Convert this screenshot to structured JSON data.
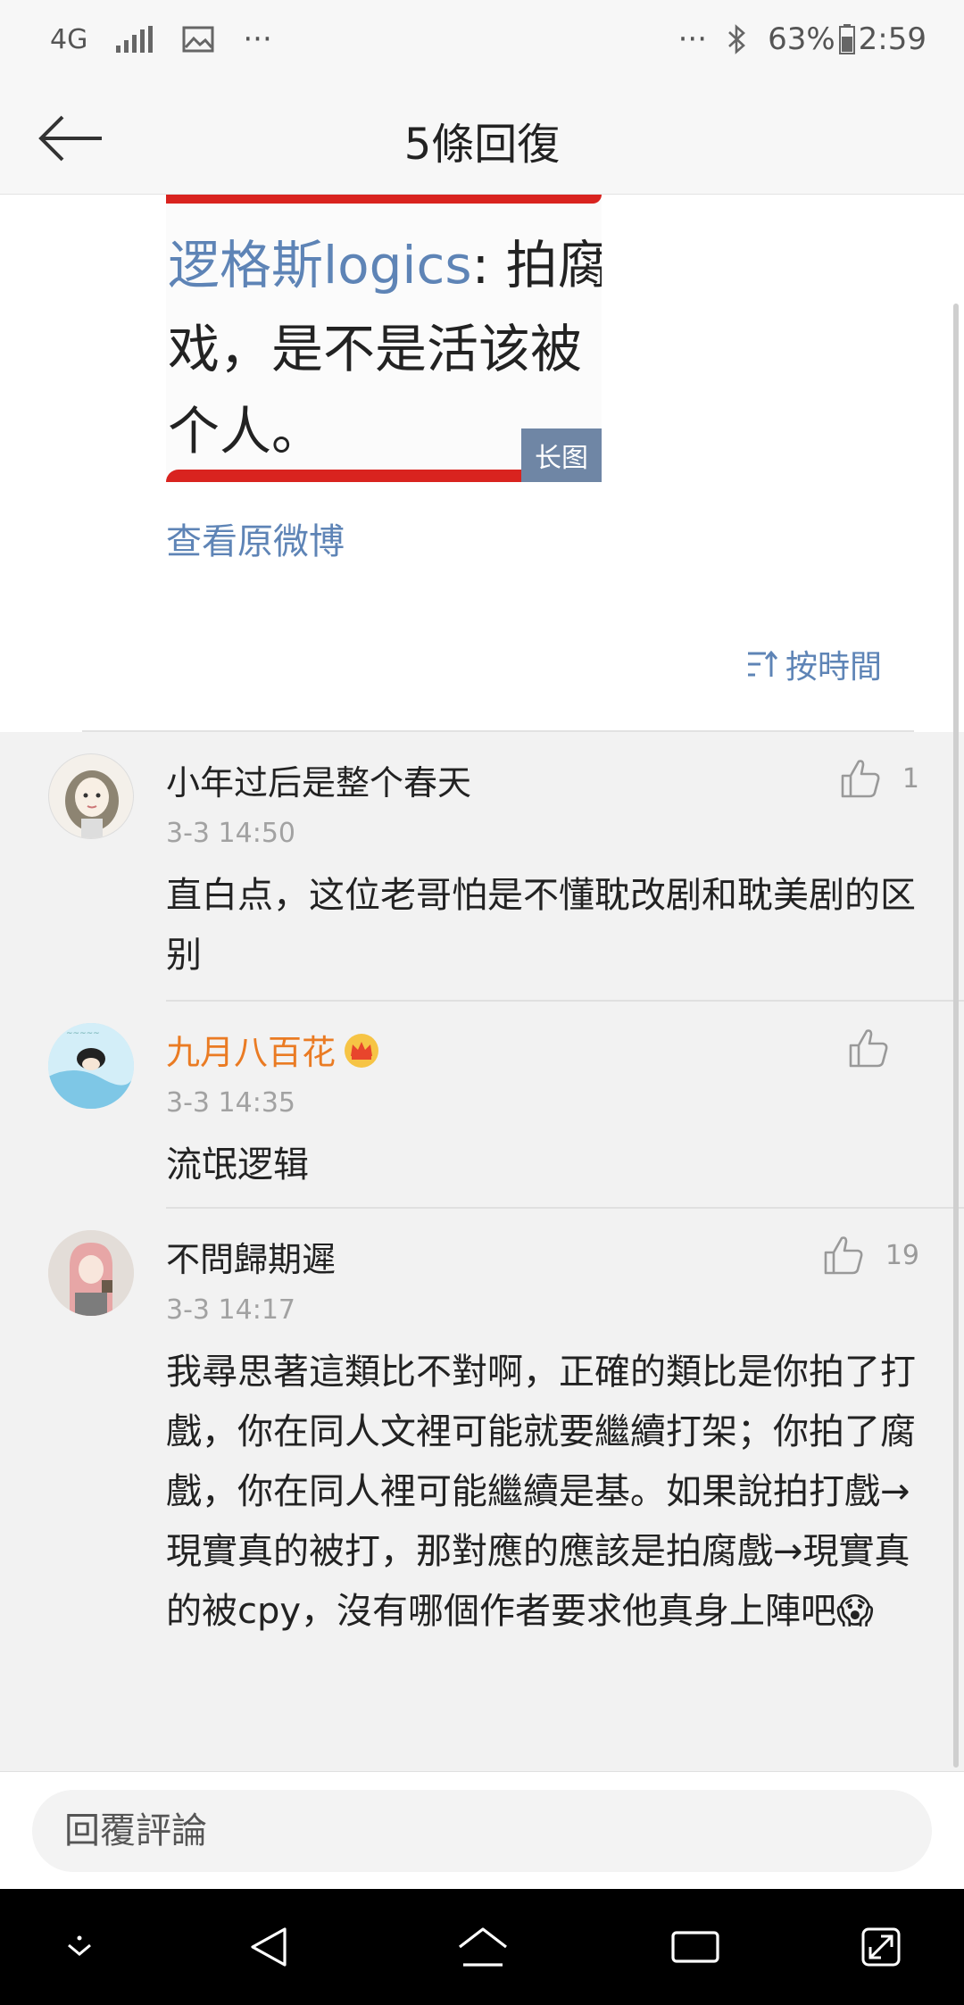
{
  "status_bar": {
    "network": "4G",
    "more_left": "···",
    "more_right": "···",
    "battery": "63%",
    "time": "2:59"
  },
  "header": {
    "title": "5條回復"
  },
  "post": {
    "image_lines": {
      "handle": "逻格斯logics",
      "line1_rest": ": 拍腐",
      "line2": "戏，是不是活该被",
      "line3": "个人。"
    },
    "long_image_badge": "长图",
    "view_original": "查看原微博",
    "sort_label": "按時間"
  },
  "comments": [
    {
      "username": "小年过后是整个春天",
      "time": "3-3 14:50",
      "text": "直白点，这位老哥怕是不懂耽改剧和耽美剧的区别",
      "likes": "1"
    },
    {
      "username": "九月八百花",
      "time": "3-3 14:35",
      "text": "流氓逻辑",
      "likes": ""
    },
    {
      "username": "不問歸期遲",
      "time": "3-3 14:17",
      "text": "我尋思著這類比不對啊，正確的類比是你拍了打戲，你在同人文裡可能就要繼續打架；你拍了腐戲，你在同人裡可能繼續是基。如果說拍打戲→現實真的被打，那對應的應該是拍腐戲→現實真的被cpy，沒有哪個作者要求他真身上陣吧😱",
      "likes": "19"
    }
  ],
  "reply": {
    "placeholder": "回覆評論"
  },
  "colors": {
    "link_blue": "#5e84b6",
    "vip_orange": "#ea7b23",
    "comment_bg": "#f2f2f2"
  }
}
